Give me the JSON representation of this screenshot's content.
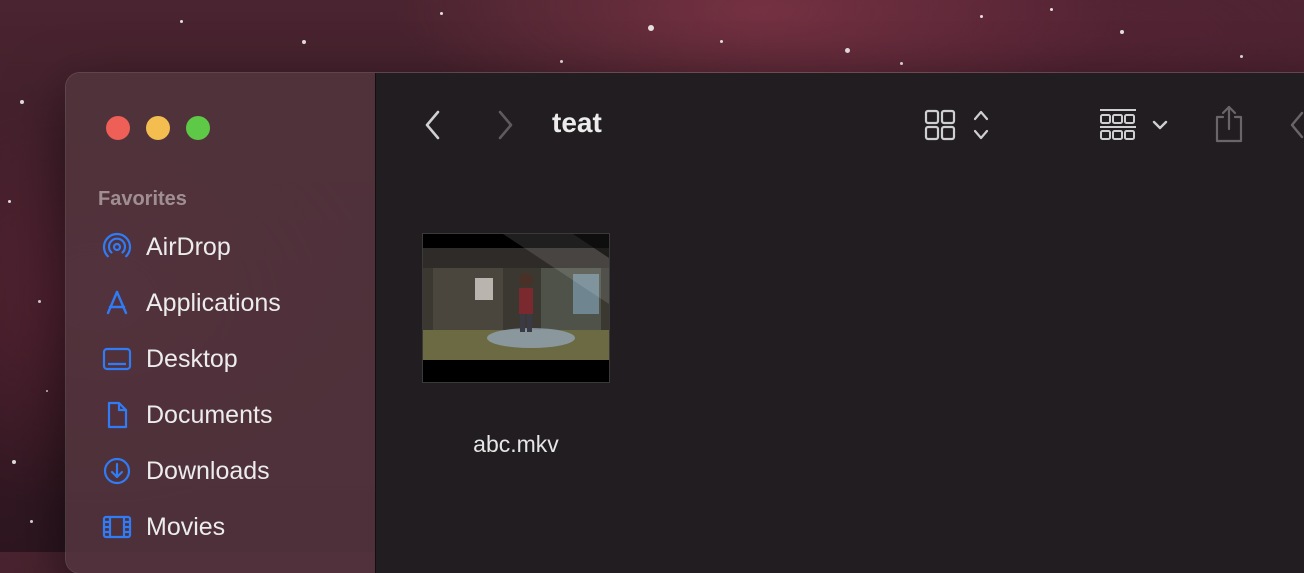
{
  "window": {
    "title": "teat",
    "traffic_lights": [
      "#ee5f57",
      "#f4bd4f",
      "#5ec946"
    ]
  },
  "sidebar": {
    "section_title": "Favorites",
    "accent_color": "#2f7cf6",
    "items": [
      {
        "label": "AirDrop",
        "icon": "airdrop-icon"
      },
      {
        "label": "Applications",
        "icon": "applications-icon"
      },
      {
        "label": "Desktop",
        "icon": "desktop-icon"
      },
      {
        "label": "Documents",
        "icon": "document-icon"
      },
      {
        "label": "Downloads",
        "icon": "downloads-icon"
      },
      {
        "label": "Movies",
        "icon": "movies-icon"
      }
    ]
  },
  "toolbar": {
    "back_icon": "chevron-left-icon",
    "forward_icon": "chevron-right-icon",
    "view_icon": "icon-grid-icon",
    "group_icon": "group-by-icon",
    "share_icon": "share-icon"
  },
  "files": [
    {
      "name": "abc.mkv",
      "thumbnail": "video-thumbnail"
    }
  ]
}
